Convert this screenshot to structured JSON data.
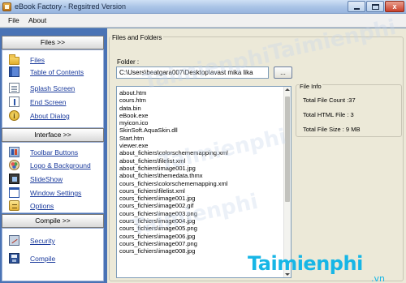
{
  "window": {
    "title": "eBook Factory - Regsitred Version",
    "controls": {
      "minimize": "",
      "maximize": "",
      "close": "x"
    }
  },
  "menu": [
    "File",
    "About"
  ],
  "sidebar": {
    "sections": [
      {
        "header": "Files >>",
        "items": [
          {
            "label": "Files",
            "icon": "folder-icon"
          },
          {
            "label": "Table of Contents",
            "icon": "book-icon"
          },
          {
            "label": "Splash Screen",
            "icon": "page-icon"
          },
          {
            "label": "End Screen",
            "icon": "page-end-icon"
          },
          {
            "label": "About Dialog",
            "icon": "info-icon"
          }
        ]
      },
      {
        "header": "Interface >>",
        "items": [
          {
            "label": "Toolbar Buttons",
            "icon": "toolbar-icon"
          },
          {
            "label": "Logo & Background",
            "icon": "palette-icon"
          },
          {
            "label": "SlideShow",
            "icon": "film-icon"
          },
          {
            "label": "Window Settings",
            "icon": "window-icon"
          },
          {
            "label": "Options",
            "icon": "options-icon"
          }
        ]
      },
      {
        "header": "Compile >>",
        "items": [
          {
            "label": "Security",
            "icon": "security-icon"
          },
          {
            "label": "Compile",
            "icon": "disk-icon"
          }
        ]
      }
    ]
  },
  "main": {
    "group_title": "Files and Folders",
    "folder_label": "Folder :",
    "folder_value": "C:\\Users\\beatgara007\\Desktop\\avast mika lika",
    "browse_label": "...",
    "files": [
      "about.htm",
      "cours.htm",
      "data.bin",
      "eBook.exe",
      "myicon.ico",
      "SkinSoft.AquaSkin.dll",
      "Start.htm",
      "viewer.exe",
      "about_fichiers\\colorschememapping.xml",
      "about_fichiers\\filelist.xml",
      "about_fichiers\\image001.jpg",
      "about_fichiers\\themedata.thmx",
      "cours_fichiers\\colorschememapping.xml",
      "cours_fichiers\\filelist.xml",
      "cours_fichiers\\image001.jpg",
      "cours_fichiers\\image002.gif",
      "cours_fichiers\\image003.png",
      "cours_fichiers\\image004.jpg",
      "cours_fichiers\\image005.png",
      "cours_fichiers\\image006.jpg",
      "cours_fichiers\\image007.png",
      "cours_fichiers\\image008.jpg"
    ],
    "info": {
      "title": "File Info",
      "count": "Total File Count :37",
      "html": "Total HTML File : 3",
      "size": "Total File Size : 9 MB"
    }
  },
  "watermark": {
    "brand": "Taimienphi",
    "suffix": ".vn"
  },
  "colors": {
    "sidebar_bg": "#4a73b5",
    "link": "#1a3a9c",
    "brand": "#17b6e6"
  }
}
